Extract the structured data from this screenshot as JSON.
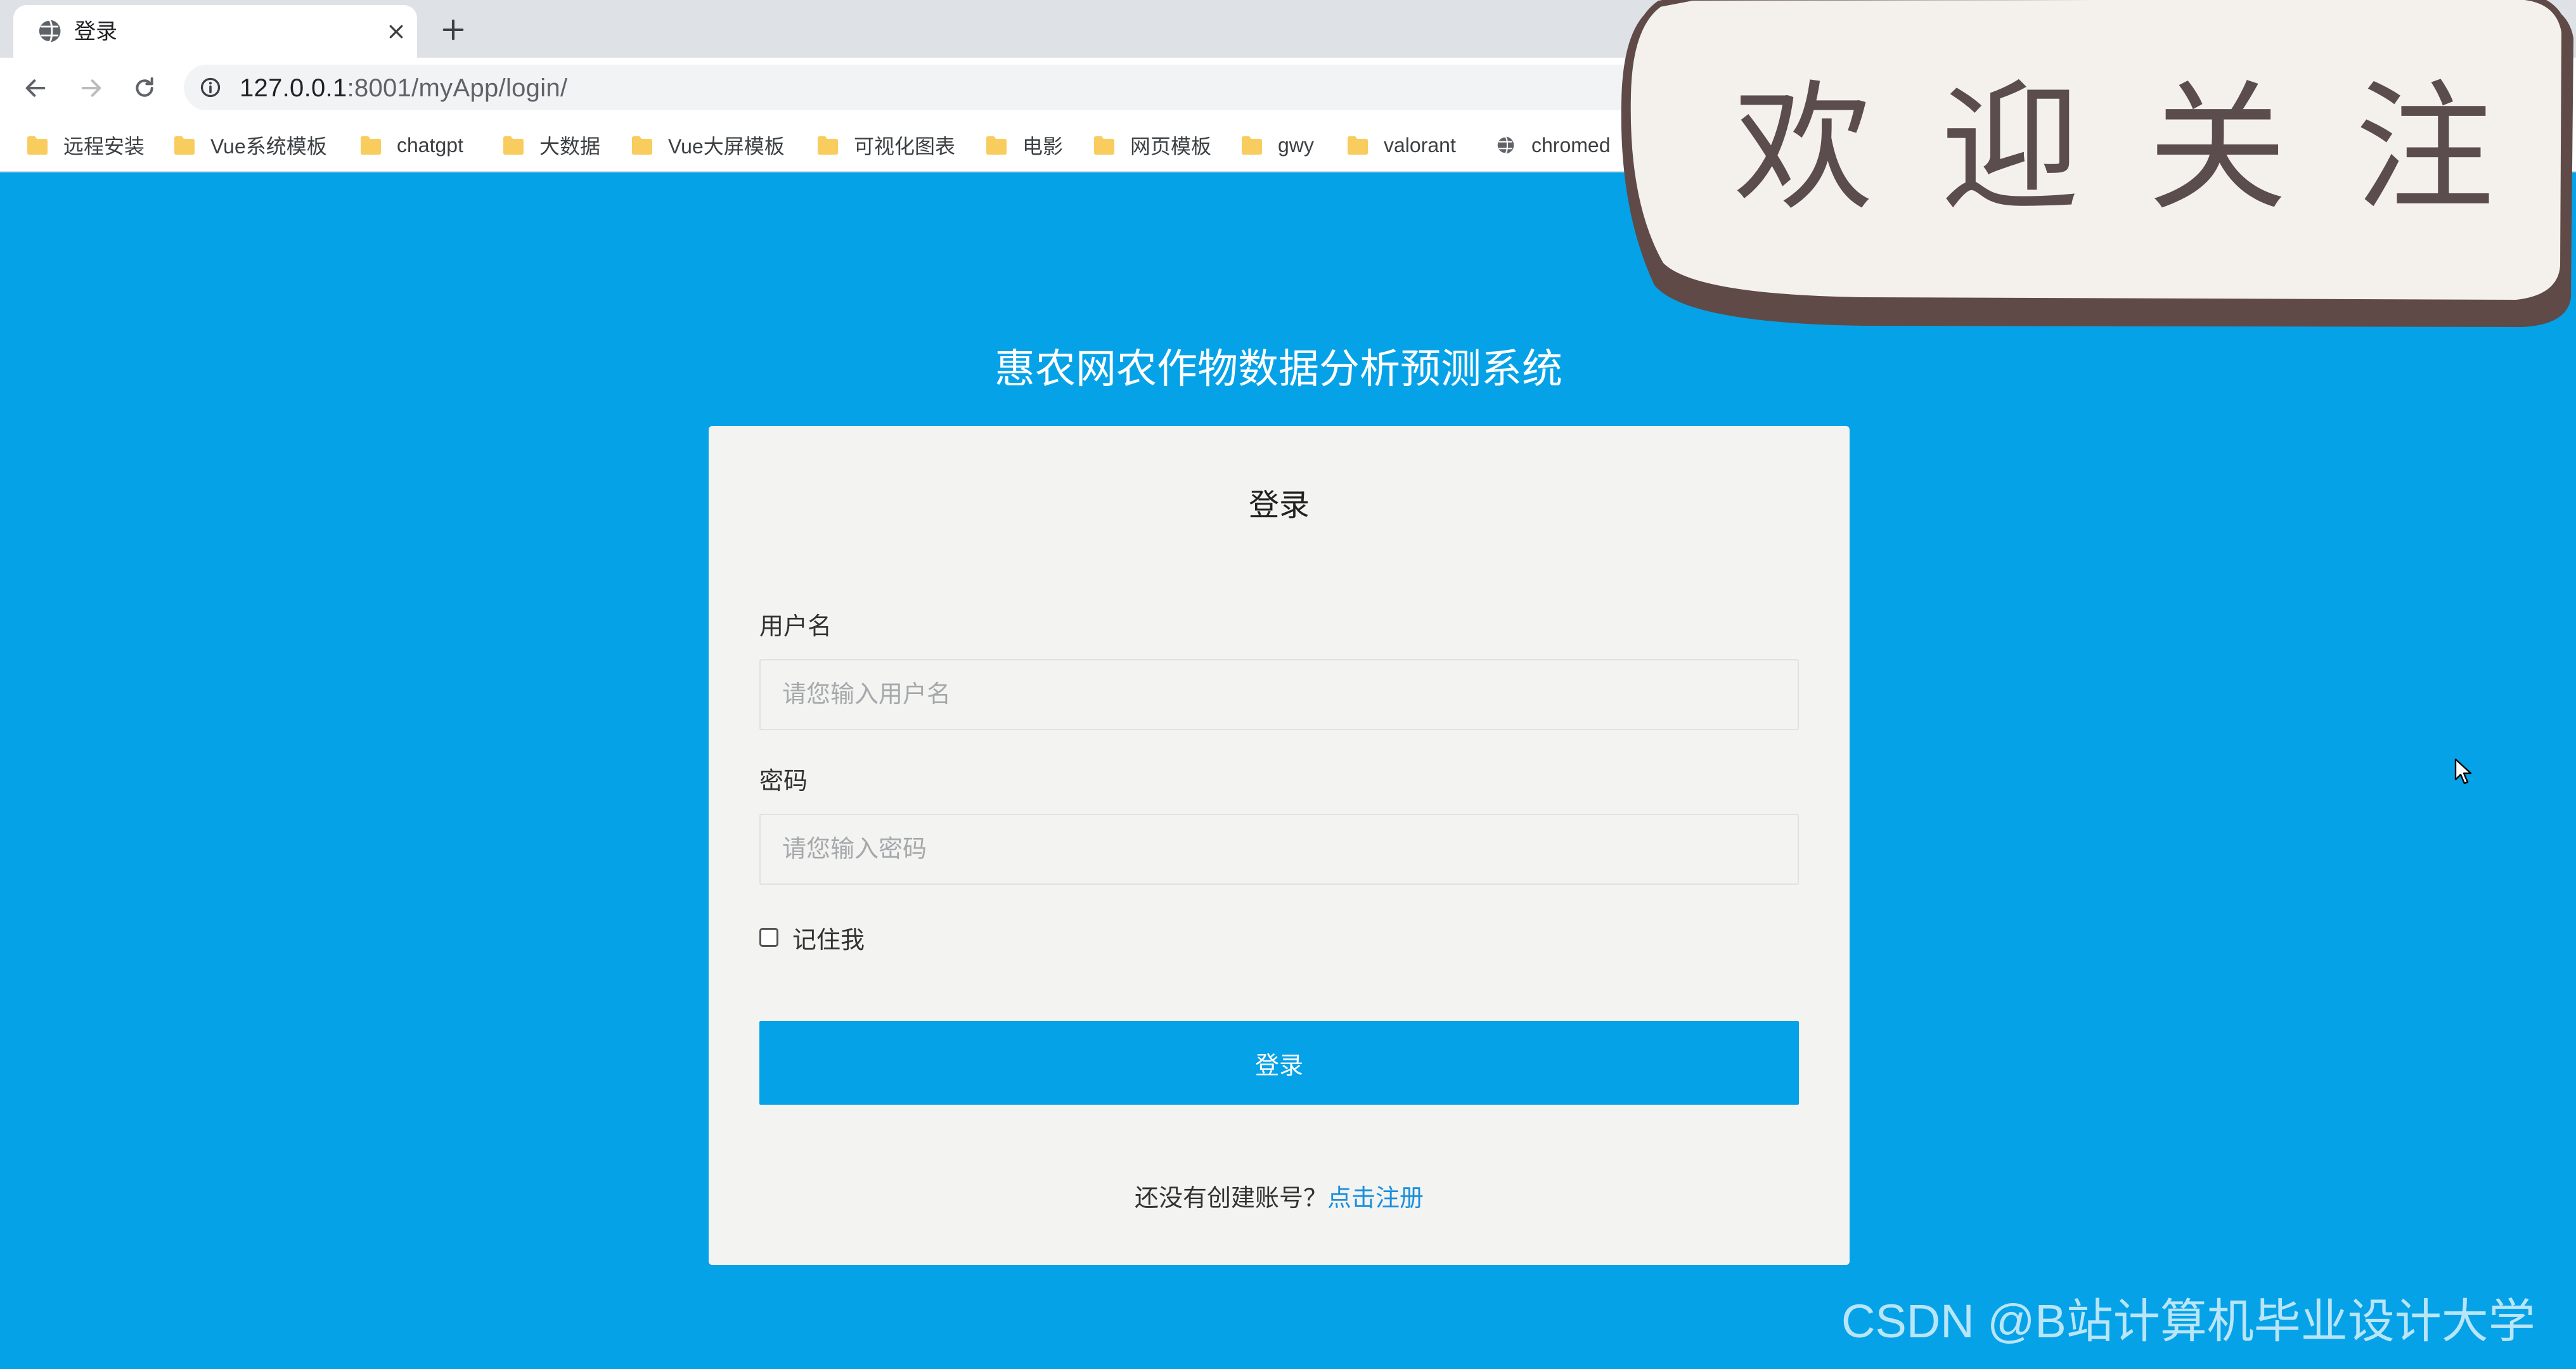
{
  "browser": {
    "tab": {
      "title": "登录",
      "favicon": "globe-icon",
      "close_icon": "close-icon"
    },
    "new_tab_icon": "plus-icon",
    "nav": {
      "back_icon": "arrow-left-icon",
      "forward_icon": "arrow-right-icon",
      "reload_icon": "reload-icon"
    },
    "address": {
      "icon": "info-icon",
      "host": "127.0.0.1",
      "rest": ":8001/myApp/login/"
    },
    "bookmarks": [
      {
        "label": "远程安装",
        "icon": "folder-icon"
      },
      {
        "label": "Vue系统模板",
        "icon": "folder-icon"
      },
      {
        "label": "chatgpt",
        "icon": "folder-icon"
      },
      {
        "label": "大数据",
        "icon": "folder-icon"
      },
      {
        "label": "Vue大屏模板",
        "icon": "folder-icon"
      },
      {
        "label": "可视化图表",
        "icon": "folder-icon"
      },
      {
        "label": "电影",
        "icon": "folder-icon"
      },
      {
        "label": "网页模板",
        "icon": "folder-icon"
      },
      {
        "label": "gwy",
        "icon": "folder-icon"
      },
      {
        "label": "valorant",
        "icon": "folder-icon"
      },
      {
        "label": "chromed",
        "icon": "globe-icon"
      }
    ]
  },
  "page": {
    "system_title": "惠农网农作物数据分析预测系统",
    "login": {
      "title": "登录",
      "username": {
        "label": "用户名",
        "placeholder": "请您输入用户名",
        "value": ""
      },
      "password": {
        "label": "密码",
        "placeholder": "请您输入密码",
        "value": ""
      },
      "remember": {
        "label": "记住我",
        "checked": false
      },
      "submit_label": "登录",
      "register_prompt": "还没有创建账号？",
      "register_link": "点击注册"
    }
  },
  "overlay": {
    "sticker_text": [
      "欢",
      "迎",
      "关",
      "注"
    ],
    "watermark": "CSDN @B站计算机毕业设计大学"
  },
  "colors": {
    "page_background": "#05a2e8",
    "card_background": "#f3f4f2",
    "button_background": "#05a2e8",
    "link": "#1a8fdc"
  }
}
